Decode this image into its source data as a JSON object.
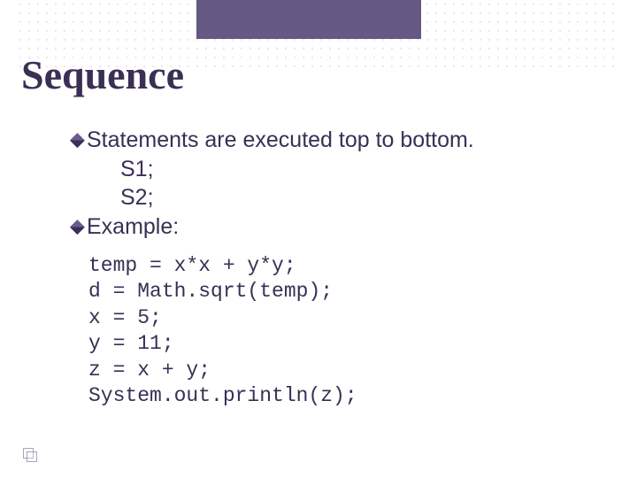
{
  "title": "Sequence",
  "bullets": {
    "b1": "Statements are executed top to bottom.",
    "b1_sub1": "S1;",
    "b1_sub2": "S2;",
    "b2": "Example:"
  },
  "code": "temp = x*x + y*y;\nd = Math.sqrt(temp);\nx = 5;\ny = 11;\nz = x + y;\nSystem.out.println(z);"
}
